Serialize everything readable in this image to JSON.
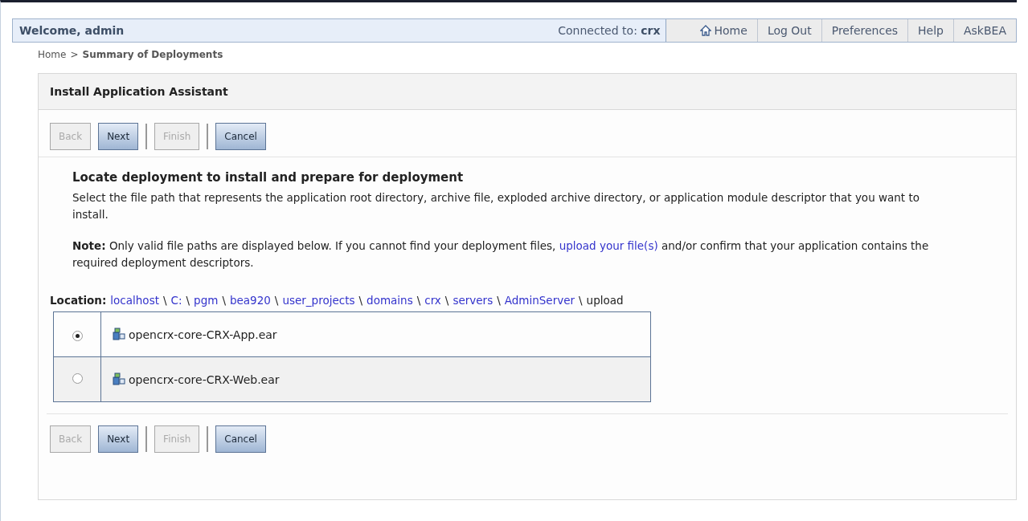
{
  "top_bar": {
    "welcome": "Welcome, admin",
    "connected_label": "Connected to:",
    "connected_value": "crx",
    "links": [
      {
        "label": "Home",
        "kind": "icon-link"
      },
      {
        "label": "Log Out",
        "kind": "text-link"
      },
      {
        "label": "Preferences",
        "kind": "text-link"
      },
      {
        "label": "Help",
        "kind": "text-link"
      },
      {
        "label": "AskBEA",
        "kind": "text-link"
      }
    ]
  },
  "breadcrumb": {
    "home": "Home",
    "separator": ">",
    "current": "Summary of Deployments"
  },
  "panel": {
    "title": "Install Application Assistant",
    "top_buttons": [
      {
        "label": "Back",
        "disabled": true
      },
      {
        "label": "Next",
        "disabled": false
      },
      {
        "label": "Finish",
        "disabled": true
      },
      {
        "label": "Cancel",
        "disabled": false
      }
    ],
    "heading": "Locate deployment to install and prepare for deployment",
    "description": "Select the file path that represents the application root directory, archive file, exploded archive directory, or application module descriptor that you want to install.",
    "note": {
      "before": "**Note:** Only valid file paths are displayed below. If you cannot find your deployment files, ",
      "link": "upload your file(s)",
      "after": " and/or confirm that your application contains the required deployment descriptors."
    },
    "location": {
      "label": "Location:",
      "separator": "\\",
      "segments": [
        {
          "text": "localhost",
          "link": true
        },
        {
          "text": "C:",
          "link": true
        },
        {
          "text": "pgm",
          "link": true
        },
        {
          "text": "bea920",
          "link": true
        },
        {
          "text": "user_projects",
          "link": true
        },
        {
          "text": "domains",
          "link": true
        },
        {
          "text": "crx",
          "link": true
        },
        {
          "text": "servers",
          "link": true
        },
        {
          "text": "AdminServer",
          "link": true
        },
        {
          "text": "upload",
          "link": false
        }
      ]
    },
    "files": [
      {
        "name": "opencrx-core-CRX-App.ear",
        "selected": true
      },
      {
        "name": "opencrx-core-CRX-Web.ear",
        "selected": false
      }
    ],
    "bottom_buttons": [
      {
        "label": "Back",
        "disabled": true
      },
      {
        "label": "Next",
        "disabled": false
      },
      {
        "label": "Finish",
        "disabled": true
      },
      {
        "label": "Cancel",
        "disabled": false
      }
    ]
  }
}
